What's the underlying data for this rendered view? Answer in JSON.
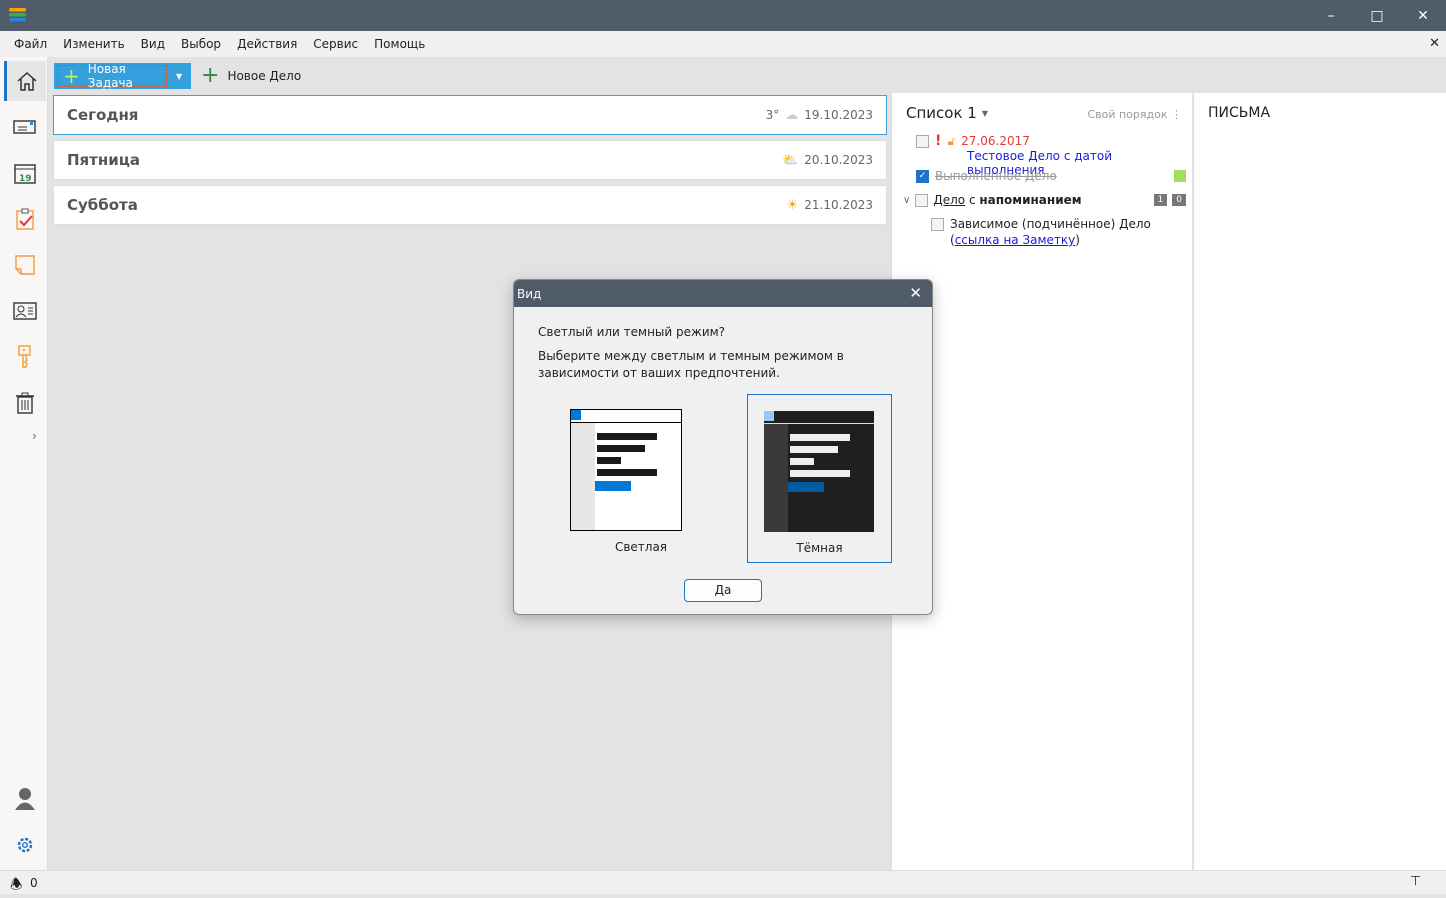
{
  "window": {
    "controls": [
      "minimize",
      "maximize",
      "close"
    ]
  },
  "menu": [
    "Файл",
    "Изменить",
    "Вид",
    "Выбор",
    "Действия",
    "Сервис",
    "Помощь"
  ],
  "toolbar": {
    "new_task": "Новая Задача",
    "new_item": "Новое Дело"
  },
  "days": [
    {
      "label": "Сегодня",
      "temp": "3°",
      "weather": "cloud",
      "date": "19.10.2023"
    },
    {
      "label": "Пятница",
      "temp": "",
      "weather": "partly-cloudy",
      "date": "20.10.2023"
    },
    {
      "label": "Суббота",
      "temp": "",
      "weather": "sun",
      "date": "21.10.2023"
    }
  ],
  "list": {
    "title": "Список 1",
    "sort": "Свой порядок",
    "item1": {
      "date": "27.06.2017",
      "text": "Тестовое Дело с датой выполнения"
    },
    "item2": {
      "text": "Выполненное Дело",
      "done": true,
      "color": "#a4dc5c"
    },
    "item3": {
      "word1": "Дело",
      "word2": "с",
      "word3": "напоминанием",
      "badge1": "1",
      "badge2": "0"
    },
    "item4": {
      "text": "Зависимое (подчинённое) Дело",
      "open": "(",
      "link": "ссылка на Заметку",
      "close": ")"
    }
  },
  "mail": {
    "title": "ПИСЬМА"
  },
  "status": {
    "notifications": "0"
  },
  "dialog": {
    "title": "Вид",
    "question": "Светлый или темный режим?",
    "description": "Выберите между светлым и темным режимом в зависимости от ваших предпочтений.",
    "light": "Светлая",
    "dark": "Тёмная",
    "selected": "dark",
    "ok": "Да"
  }
}
